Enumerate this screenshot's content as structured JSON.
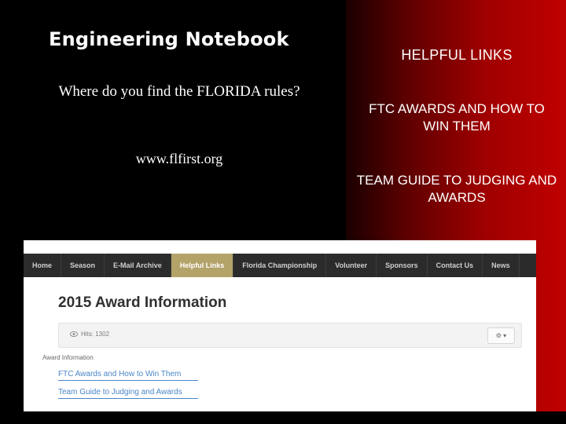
{
  "slide": {
    "title": "Engineering Notebook",
    "question": "Where do you find the FLORIDA rules?",
    "url": "www.flfirst.org",
    "right_panel": {
      "heading": "HELPFUL LINKS",
      "link_1": "FTC AWARDS AND HOW TO WIN THEM",
      "link_2": "TEAM GUIDE TO JUDGING AND AWARDS"
    },
    "screenshot": {
      "nav_items": [
        {
          "label": "Home",
          "active": false
        },
        {
          "label": "Season",
          "active": false
        },
        {
          "label": "E-Mail Archive",
          "active": false
        },
        {
          "label": "Helpful Links",
          "active": true
        },
        {
          "label": "Florida Championship",
          "active": false
        },
        {
          "label": "Volunteer",
          "active": false
        },
        {
          "label": "Sponsors",
          "active": false
        },
        {
          "label": "Contact Us",
          "active": false
        },
        {
          "label": "News",
          "active": false
        }
      ],
      "page_title": "2015 Award Information",
      "hits": "Hits: 1302",
      "gear_button": "⚙ ▾",
      "section_label": "Award Information",
      "links": [
        "FTC Awards and How to Win Them",
        "Team Guide to Judging and Awards"
      ]
    }
  }
}
